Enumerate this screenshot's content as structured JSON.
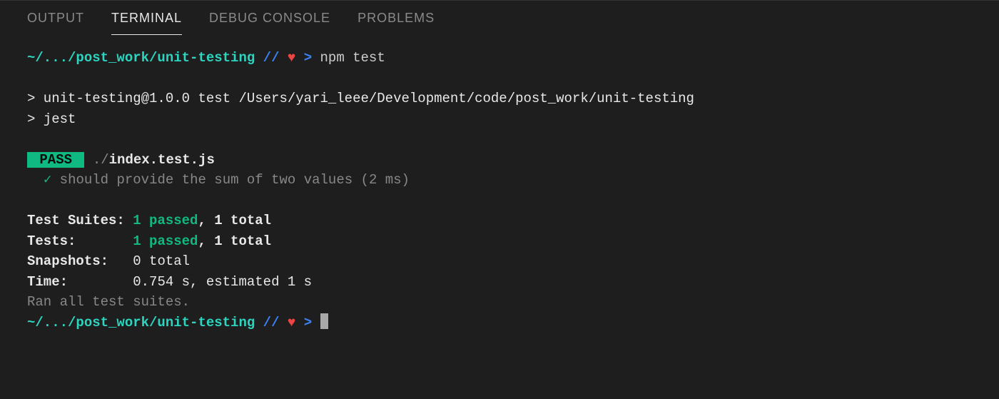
{
  "tabs": {
    "output": "OUTPUT",
    "terminal": "TERMINAL",
    "debug": "DEBUG CONSOLE",
    "problems": "PROBLEMS"
  },
  "prompt": {
    "cwd": "~/.../post_work/unit-testing",
    "separator": "//",
    "heart": "♥",
    "arrow": ">",
    "command": "npm test"
  },
  "output": {
    "npm_header": "> unit-testing@1.0.0 test /Users/yari_leee/Development/code/post_work/unit-testing",
    "npm_runner": "> jest",
    "pass_label": " PASS ",
    "test_file_prefix": " ./",
    "test_file": "index.test.js",
    "test_line_pre": "  ",
    "check": "✓",
    "test_name": " should provide the sum of two values (2 ms)"
  },
  "summary": {
    "suites_label": "Test Suites: ",
    "suites_passed": "1 passed",
    "suites_total": ", 1 total",
    "tests_label": "Tests:       ",
    "tests_passed": "1 passed",
    "tests_total": ", 1 total",
    "snapshots_label": "Snapshots:   ",
    "snapshots_value": "0 total",
    "time_label": "Time:        ",
    "time_value": "0.754 s, estimated 1 s",
    "footer": "Ran all test suites."
  }
}
